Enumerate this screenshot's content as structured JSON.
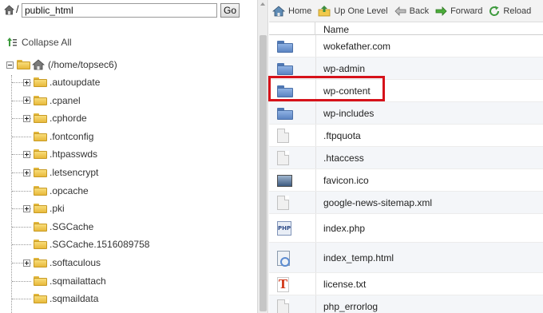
{
  "pathbar": {
    "slash": "/",
    "path_value": "public_html",
    "go_label": "Go"
  },
  "tree": {
    "collapse_all": "Collapse All",
    "root_label": "(/home/topsec6)",
    "items": [
      {
        "label": ".autoupdate",
        "expandable": true
      },
      {
        "label": ".cpanel",
        "expandable": true
      },
      {
        "label": ".cphorde",
        "expandable": true
      },
      {
        "label": ".fontconfig",
        "expandable": false
      },
      {
        "label": ".htpasswds",
        "expandable": true
      },
      {
        "label": ".letsencrypt",
        "expandable": true
      },
      {
        "label": ".opcache",
        "expandable": false
      },
      {
        "label": ".pki",
        "expandable": true
      },
      {
        "label": ".SGCache",
        "expandable": false
      },
      {
        "label": ".SGCache.1516089758",
        "expandable": false
      },
      {
        "label": ".softaculous",
        "expandable": true
      },
      {
        "label": ".sqmailattach",
        "expandable": false
      },
      {
        "label": ".sqmaildata",
        "expandable": false
      }
    ]
  },
  "toolbar": {
    "home": "Home",
    "up": "Up One Level",
    "back": "Back",
    "forward": "Forward",
    "reload": "Reload"
  },
  "list": {
    "name_header": "Name",
    "files": [
      {
        "name": "wokefather.com",
        "icon": "folder-icon"
      },
      {
        "name": "wp-admin",
        "icon": "folder-icon"
      },
      {
        "name": "wp-content",
        "icon": "folder-icon"
      },
      {
        "name": "wp-includes",
        "icon": "folder-icon"
      },
      {
        "name": ".ftpquota",
        "icon": "file-icon"
      },
      {
        "name": ".htaccess",
        "icon": "file-icon"
      },
      {
        "name": "favicon.ico",
        "icon": "image-icon"
      },
      {
        "name": "google-news-sitemap.xml",
        "icon": "file-icon"
      },
      {
        "name": "index.php",
        "icon": "php-icon"
      },
      {
        "name": "index_temp.html",
        "icon": "html-icon"
      },
      {
        "name": "license.txt",
        "icon": "text-icon"
      },
      {
        "name": "php_errorlog",
        "icon": "file-icon"
      }
    ],
    "highlighted": "wp-content"
  },
  "colors": {
    "highlight": "#d6121a",
    "folder_yellow": "#e8b93b",
    "folder_blue": "#5b84c2"
  }
}
